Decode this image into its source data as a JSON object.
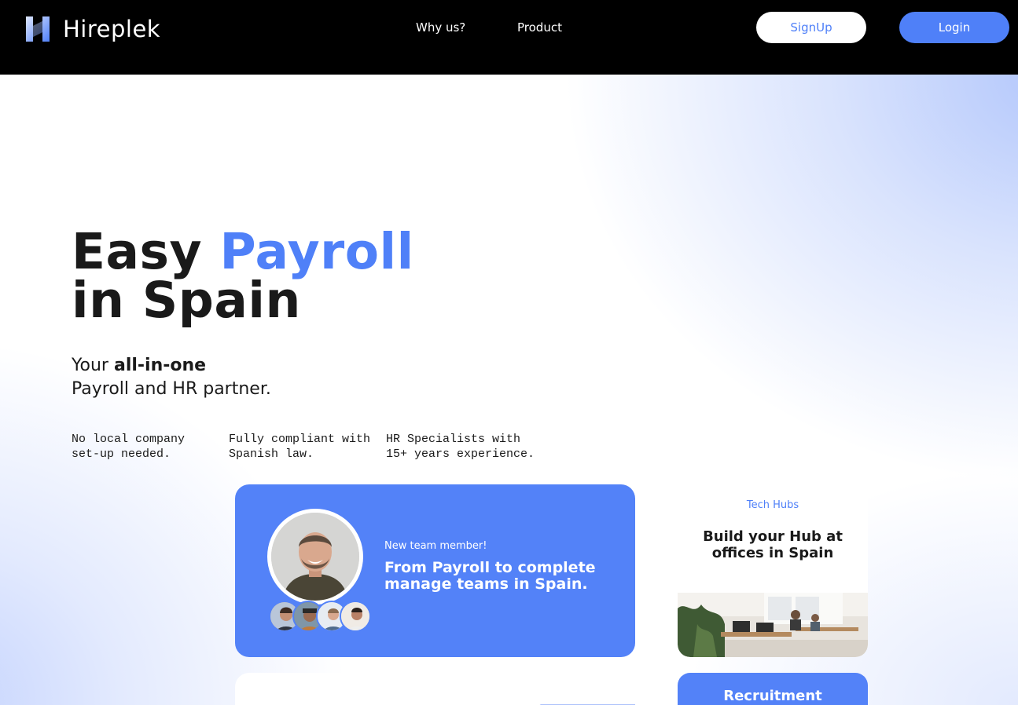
{
  "brand": {
    "name": "Hireplek",
    "accent": "#4f80f8",
    "nav_bg": "#000000"
  },
  "nav": {
    "links": [
      "Why us?",
      "Product"
    ],
    "signup_label": "SignUp",
    "login_label": "Login"
  },
  "hero": {
    "headline_part1": "Easy ",
    "headline_accent": "Payroll",
    "headline_part2": "in Spain",
    "subhead_prefix": "Your ",
    "subhead_bold": "all-in-one",
    "subhead_line2": "Payroll and HR partner.",
    "features": [
      {
        "line1": "No local company",
        "line2": "set-up needed."
      },
      {
        "line1": "Fully compliant with",
        "line2": "Spanish law."
      },
      {
        "line1": "HR Specialists with",
        "line2": "15+ years experience."
      }
    ]
  },
  "cards": {
    "team": {
      "eyebrow": "New team member!",
      "title": "From Payroll to complete manage teams in Spain."
    },
    "hub": {
      "eyebrow": "Tech Hubs",
      "title": "Build your Hub at offices in Spain"
    },
    "recruitment": {
      "title": "Recruitment"
    }
  }
}
